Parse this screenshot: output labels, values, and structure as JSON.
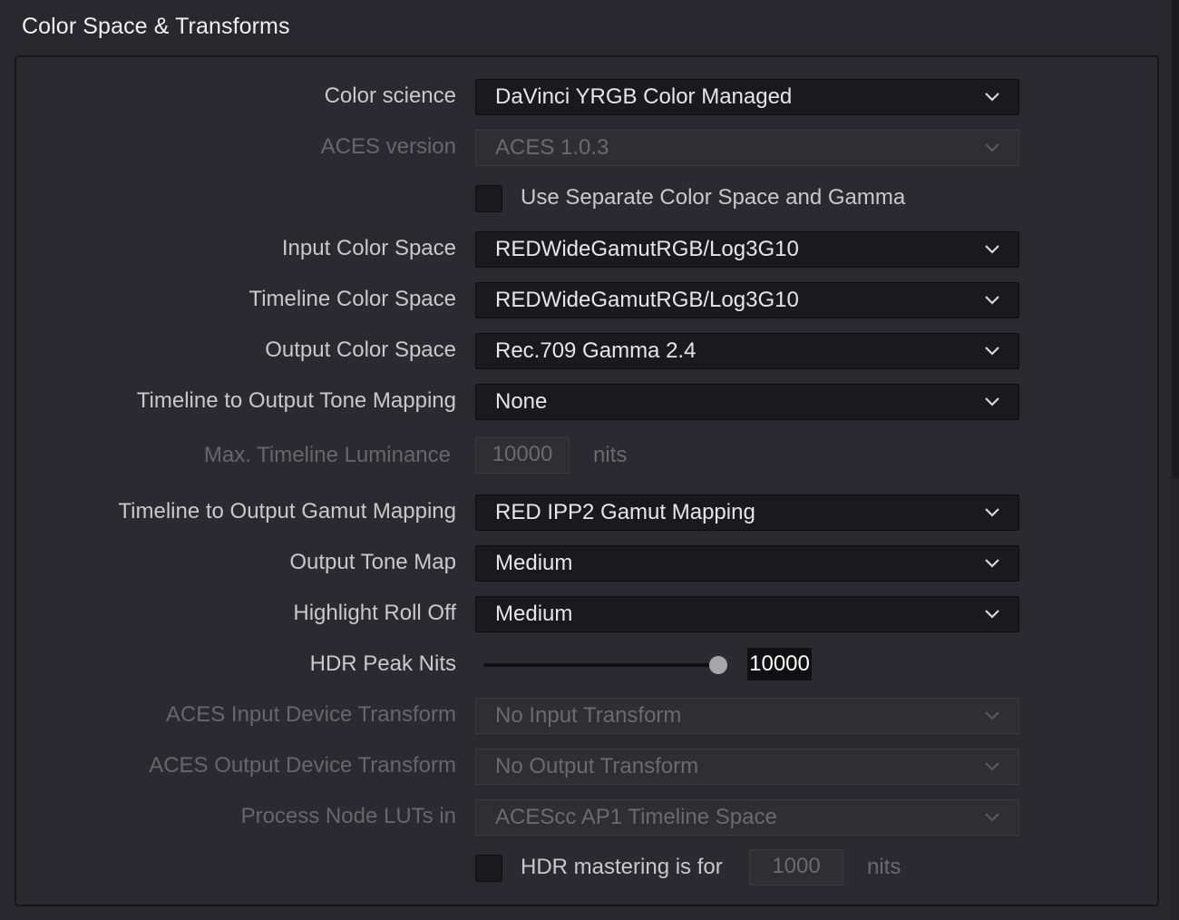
{
  "section": {
    "title": "Color Space & Transforms"
  },
  "rows": {
    "color_science": {
      "label": "Color science",
      "value": "DaVinci YRGB Color Managed"
    },
    "aces_version": {
      "label": "ACES version",
      "value": "ACES 1.0.3"
    },
    "separate_cs_gamma": {
      "label": "Use Separate Color Space and Gamma",
      "checked": false
    },
    "input_color_space": {
      "label": "Input Color Space",
      "value": "REDWideGamutRGB/Log3G10"
    },
    "timeline_color_space": {
      "label": "Timeline Color Space",
      "value": "REDWideGamutRGB/Log3G10"
    },
    "output_color_space": {
      "label": "Output Color Space",
      "value": "Rec.709 Gamma 2.4"
    },
    "tone_mapping": {
      "label": "Timeline to Output Tone Mapping",
      "value": "None"
    },
    "max_luminance": {
      "label": "Max. Timeline Luminance",
      "value": "10000",
      "unit": "nits"
    },
    "gamut_mapping": {
      "label": "Timeline to Output Gamut Mapping",
      "value": "RED IPP2 Gamut Mapping"
    },
    "output_tone_map": {
      "label": "Output Tone Map",
      "value": "Medium"
    },
    "highlight_roll_off": {
      "label": "Highlight Roll Off",
      "value": "Medium"
    },
    "hdr_peak_nits": {
      "label": "HDR Peak Nits",
      "value": "10000",
      "slider_level": 1.0
    },
    "aces_input_transform": {
      "label": "ACES Input Device Transform",
      "value": "No Input Transform"
    },
    "aces_output_transform": {
      "label": "ACES Output Device Transform",
      "value": "No Output Transform"
    },
    "process_node_luts": {
      "label": "Process Node LUTs in",
      "value": "ACEScc AP1 Timeline Space"
    },
    "hdr_mastering": {
      "label": "HDR mastering is for",
      "value": "1000",
      "unit": "nits",
      "checked": false
    }
  },
  "icons": {
    "dropdown": "chevron-down-icon"
  },
  "colors": {
    "background": "#28282e",
    "field": "#1a1a1c",
    "label": "#c9c9cc",
    "disabled_text": "#66666b"
  }
}
